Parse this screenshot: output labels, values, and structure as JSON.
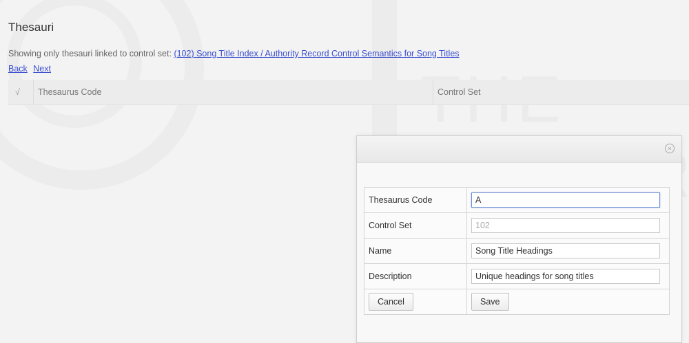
{
  "page": {
    "title": "Thesauri",
    "filter_prefix": "Showing only thesauri linked to control set:",
    "filter_link": "(102) Song Title Index / Authority Record Control Semantics for Song Titles",
    "back_label": "Back",
    "next_label": "Next"
  },
  "grid": {
    "check_mark": "√",
    "columns": [
      "Thesaurus Code",
      "Control Set"
    ]
  },
  "dialog": {
    "close_glyph": "×",
    "fields": [
      {
        "label": "Thesaurus Code",
        "value": "A"
      },
      {
        "label": "Control Set",
        "value": "102"
      },
      {
        "label": "Name",
        "value": "Song Title Headings"
      },
      {
        "label": "Description",
        "value": "Unique headings for song titles"
      }
    ],
    "cancel_label": "Cancel",
    "save_label": "Save"
  }
}
